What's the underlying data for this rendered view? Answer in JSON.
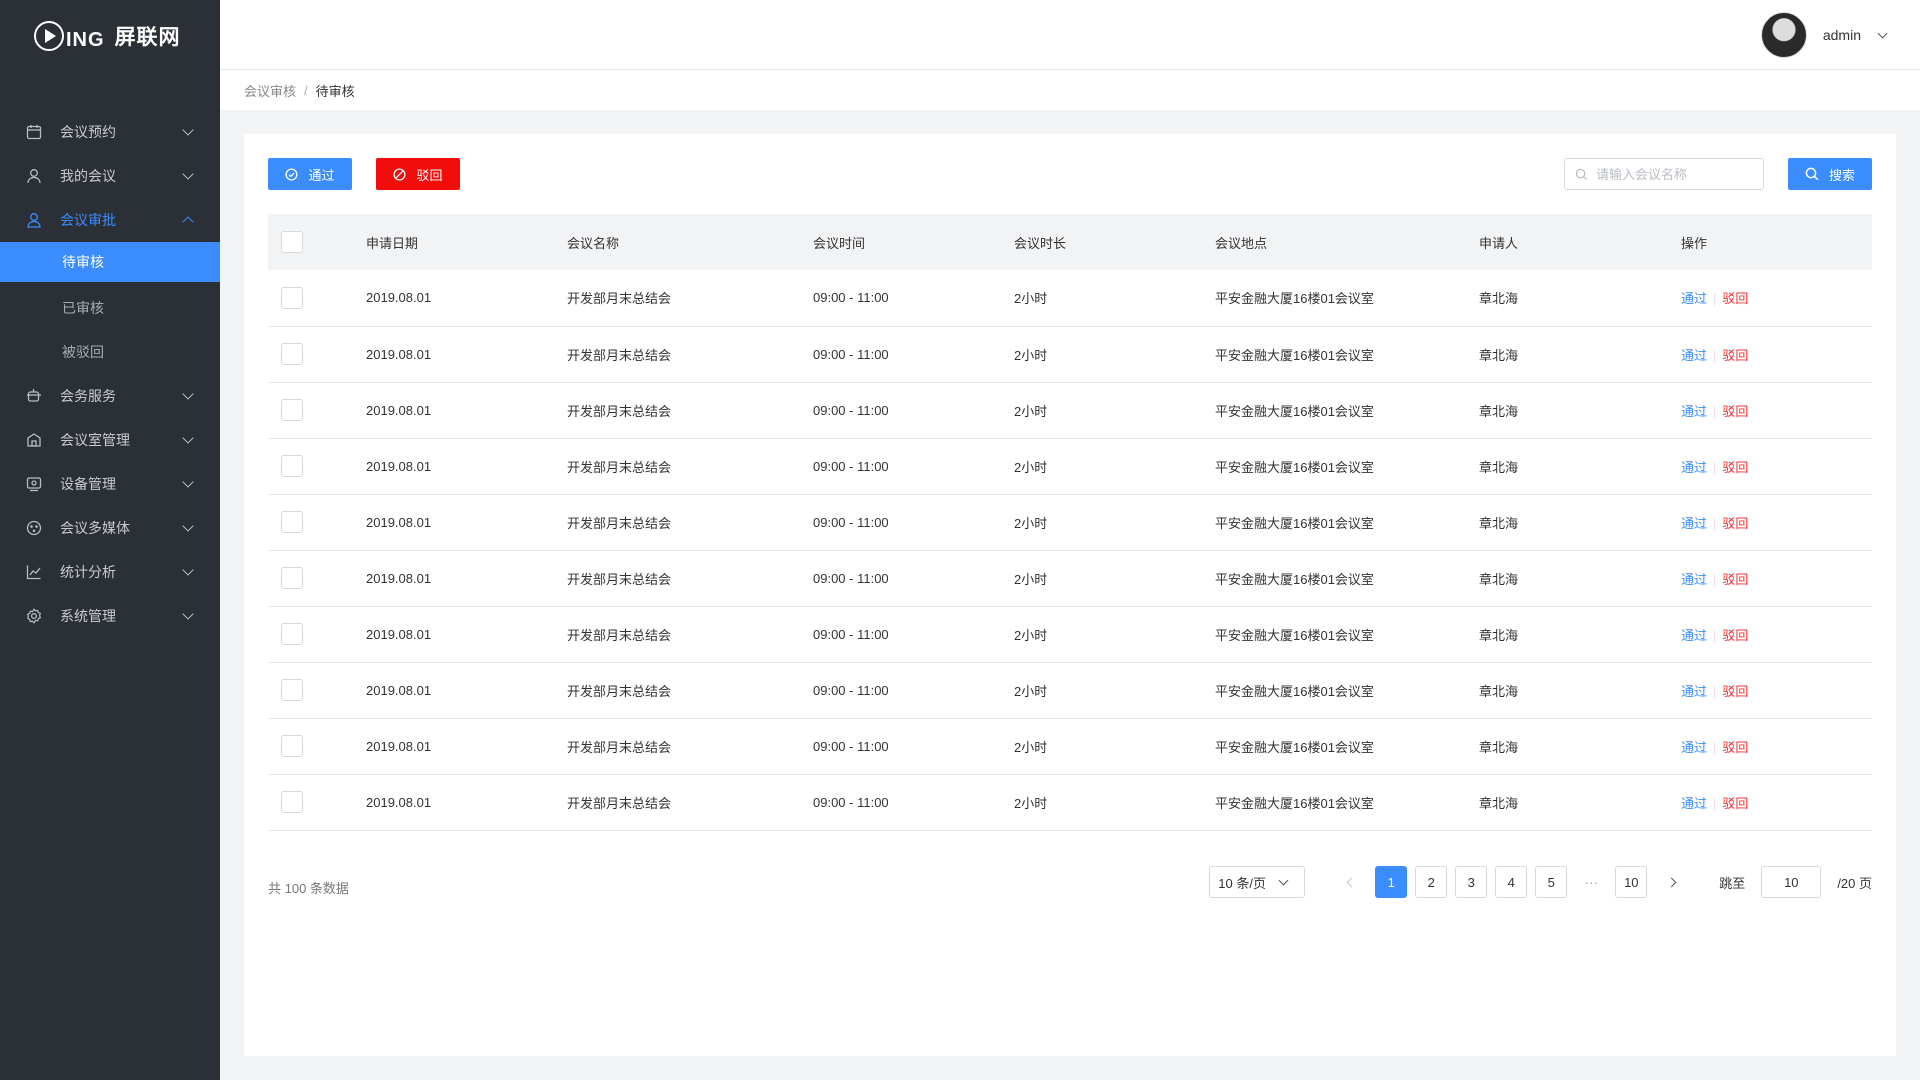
{
  "brand": {
    "logo_text": "ING",
    "name": "屏联网"
  },
  "sidebar": {
    "items": [
      {
        "label": "会议预约",
        "icon": "calendar-icon"
      },
      {
        "label": "我的会议",
        "icon": "user-icon"
      },
      {
        "label": "会议审批",
        "icon": "approve-user-icon",
        "open": true,
        "children": [
          {
            "label": "待审核",
            "active": true
          },
          {
            "label": "已审核"
          },
          {
            "label": "被驳回"
          }
        ]
      },
      {
        "label": "会务服务",
        "icon": "tea-cup-icon"
      },
      {
        "label": "会议室管理",
        "icon": "room-icon"
      },
      {
        "label": "设备管理",
        "icon": "device-icon"
      },
      {
        "label": "会议多媒体",
        "icon": "media-icon"
      },
      {
        "label": "统计分析",
        "icon": "chart-icon"
      },
      {
        "label": "系统管理",
        "icon": "gear-icon"
      }
    ]
  },
  "header": {
    "username": "admin"
  },
  "breadcrumb": {
    "parent": "会议审核",
    "separator": "/",
    "current": "待审核"
  },
  "toolbar": {
    "pass_label": "通过",
    "reject_label": "驳回",
    "search_placeholder": "请输入会议名称",
    "search_label": "搜索"
  },
  "table": {
    "columns": [
      "申请日期",
      "会议名称",
      "会议时间",
      "会议时长",
      "会议地点",
      "申请人",
      "操作"
    ],
    "rows": [
      {
        "date": "2019.08.01",
        "name": "开发部月末总结会",
        "time": "09:00 - 11:00",
        "duration": "2小时",
        "location": "平安金融大厦16楼01会议室",
        "applicant": "章北海"
      },
      {
        "date": "2019.08.01",
        "name": "开发部月末总结会",
        "time": "09:00 - 11:00",
        "duration": "2小时",
        "location": "平安金融大厦16楼01会议室",
        "applicant": "章北海"
      },
      {
        "date": "2019.08.01",
        "name": "开发部月末总结会",
        "time": "09:00 - 11:00",
        "duration": "2小时",
        "location": "平安金融大厦16楼01会议室",
        "applicant": "章北海"
      },
      {
        "date": "2019.08.01",
        "name": "开发部月末总结会",
        "time": "09:00 - 11:00",
        "duration": "2小时",
        "location": "平安金融大厦16楼01会议室",
        "applicant": "章北海"
      },
      {
        "date": "2019.08.01",
        "name": "开发部月末总结会",
        "time": "09:00 - 11:00",
        "duration": "2小时",
        "location": "平安金融大厦16楼01会议室",
        "applicant": "章北海"
      },
      {
        "date": "2019.08.01",
        "name": "开发部月末总结会",
        "time": "09:00 - 11:00",
        "duration": "2小时",
        "location": "平安金融大厦16楼01会议室",
        "applicant": "章北海"
      },
      {
        "date": "2019.08.01",
        "name": "开发部月末总结会",
        "time": "09:00 - 11:00",
        "duration": "2小时",
        "location": "平安金融大厦16楼01会议室",
        "applicant": "章北海"
      },
      {
        "date": "2019.08.01",
        "name": "开发部月末总结会",
        "time": "09:00 - 11:00",
        "duration": "2小时",
        "location": "平安金融大厦16楼01会议室",
        "applicant": "章北海"
      },
      {
        "date": "2019.08.01",
        "name": "开发部月末总结会",
        "time": "09:00 - 11:00",
        "duration": "2小时",
        "location": "平安金融大厦16楼01会议室",
        "applicant": "章北海"
      },
      {
        "date": "2019.08.01",
        "name": "开发部月末总结会",
        "time": "09:00 - 11:00",
        "duration": "2小时",
        "location": "平安金融大厦16楼01会议室",
        "applicant": "章北海"
      }
    ],
    "action_pass": "通过",
    "action_reject": "驳回"
  },
  "pagination": {
    "total_text": "共 100 条数据",
    "page_size": "10 条/页",
    "pages": [
      "1",
      "2",
      "3",
      "4",
      "5"
    ],
    "ellipsis": "···",
    "last_page": "10",
    "current_page": "1",
    "jump_label": "跳至",
    "jump_value": "10",
    "total_pages": "/20 页"
  },
  "colors": {
    "primary": "#3a8cff",
    "danger": "#f20c0c",
    "sidebar_bg": "#2b2f36"
  }
}
